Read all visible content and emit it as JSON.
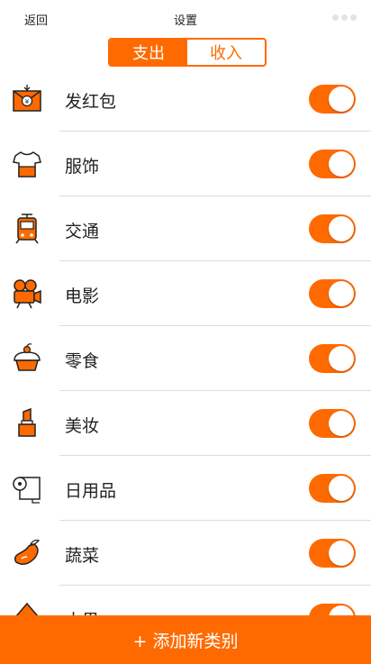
{
  "header": {
    "back_label": "返回",
    "title": "设置"
  },
  "tabs": [
    {
      "label": "支出",
      "active": true
    },
    {
      "label": "收入",
      "active": false
    }
  ],
  "categories": [
    {
      "label": "发红包",
      "icon": "red-envelope-icon",
      "enabled": true
    },
    {
      "label": "服饰",
      "icon": "tshirt-icon",
      "enabled": true
    },
    {
      "label": "交通",
      "icon": "tram-icon",
      "enabled": true
    },
    {
      "label": "电影",
      "icon": "movie-camera-icon",
      "enabled": true
    },
    {
      "label": "零食",
      "icon": "cupcake-icon",
      "enabled": true
    },
    {
      "label": "美妆",
      "icon": "lipstick-icon",
      "enabled": true
    },
    {
      "label": "日用品",
      "icon": "tissue-roll-icon",
      "enabled": true
    },
    {
      "label": "蔬菜",
      "icon": "eggplant-icon",
      "enabled": true
    },
    {
      "label": "水果",
      "icon": "fruit-icon",
      "enabled": true
    }
  ],
  "footer": {
    "add_label": "+ 添加新类别"
  },
  "colors": {
    "accent": "#ff6a00",
    "separator": "#dcdcdc"
  }
}
